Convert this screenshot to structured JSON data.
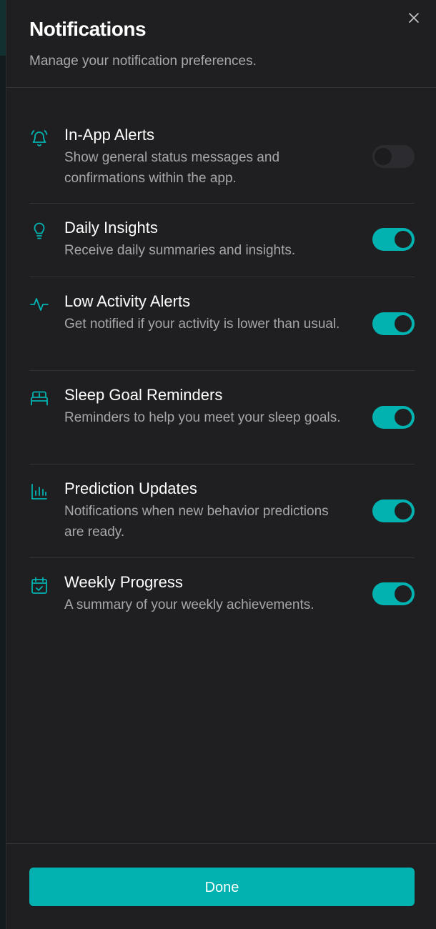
{
  "header": {
    "title": "Notifications",
    "subtitle": "Manage your notification preferences."
  },
  "settings": [
    {
      "icon": "bell-ringing-icon",
      "label": "In-App Alerts",
      "description": "Show general status messages and confirmations within the app.",
      "enabled": false
    },
    {
      "icon": "lightbulb-icon",
      "label": "Daily Insights",
      "description": "Receive daily summaries and insights.",
      "enabled": true
    },
    {
      "icon": "activity-pulse-icon",
      "label": "Low Activity Alerts",
      "description": "Get notified if your activity is lower than usual.",
      "enabled": true
    },
    {
      "icon": "bed-icon",
      "label": "Sleep Goal Reminders",
      "description": "Reminders to help you meet your sleep goals.",
      "enabled": true
    },
    {
      "icon": "bar-chart-icon",
      "label": "Prediction Updates",
      "description": "Notifications when new behavior predictions are ready.",
      "enabled": true
    },
    {
      "icon": "calendar-check-icon",
      "label": "Weekly Progress",
      "description": "A summary of your weekly achievements.",
      "enabled": true
    }
  ],
  "footer": {
    "done_label": "Done"
  },
  "colors": {
    "accent": "#02b2b0",
    "panel": "#1f1f21",
    "toggle_off": "#2c2c30"
  }
}
